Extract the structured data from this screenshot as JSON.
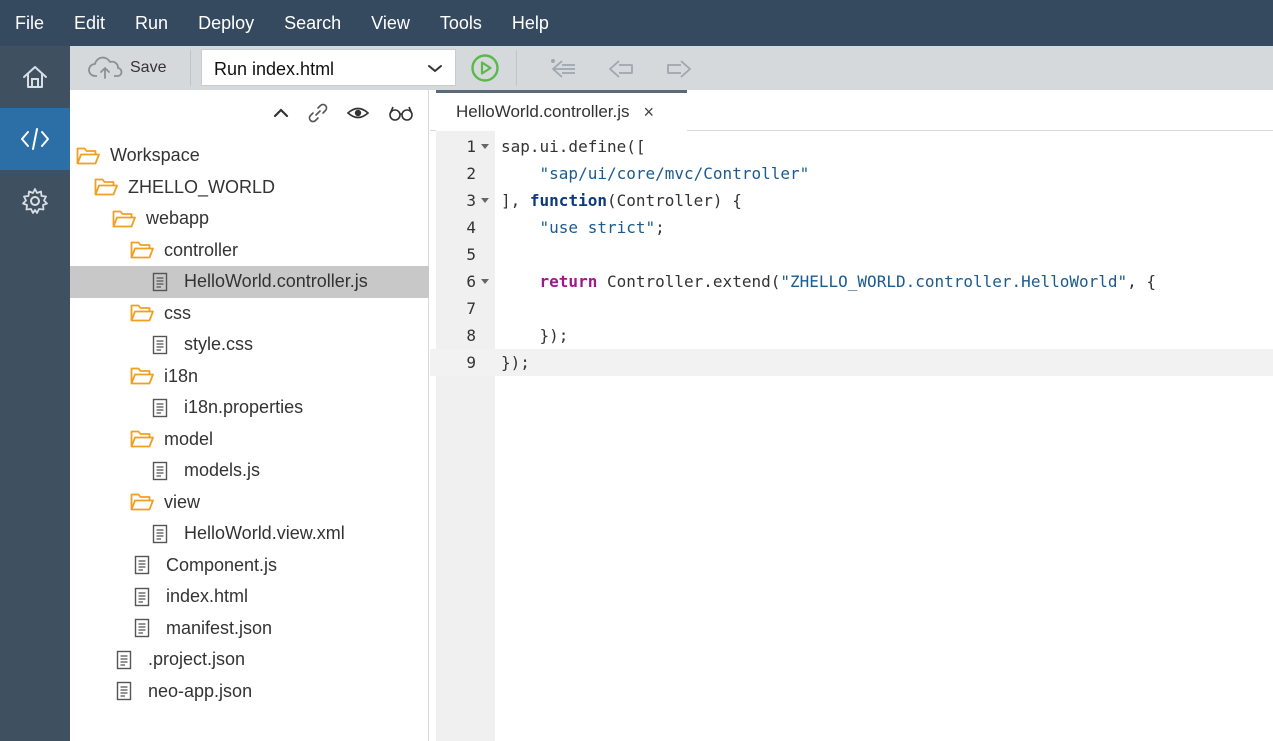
{
  "menu": [
    "File",
    "Edit",
    "Run",
    "Deploy",
    "Search",
    "View",
    "Tools",
    "Help"
  ],
  "rail": {
    "items": [
      {
        "icon": "home-icon"
      },
      {
        "icon": "code-editor-icon",
        "active": true
      },
      {
        "icon": "gear-icon"
      }
    ]
  },
  "toolbar": {
    "save_label": "Save",
    "run_config": "Run index.html",
    "icons": [
      "cloud-upload-icon",
      "chevron-down-icon",
      "run-icon",
      "previous-error-icon",
      "back-icon",
      "forward-icon"
    ]
  },
  "sidepanel": {
    "toolbar_icons": [
      "collapse-icon",
      "link-icon",
      "show-hidden-icon",
      "glasses-icon"
    ],
    "tree": [
      {
        "label": "Workspace",
        "type": "folder",
        "level": 0
      },
      {
        "label": "ZHELLO_WORLD",
        "type": "folder",
        "level": 1
      },
      {
        "label": "webapp",
        "type": "folder",
        "level": 2
      },
      {
        "label": "controller",
        "type": "folder",
        "level": 3
      },
      {
        "label": "HelloWorld.controller.js",
        "type": "file",
        "level": 4,
        "selected": true
      },
      {
        "label": "css",
        "type": "folder",
        "level": 3
      },
      {
        "label": "style.css",
        "type": "file",
        "level": 4
      },
      {
        "label": "i18n",
        "type": "folder",
        "level": 3
      },
      {
        "label": "i18n.properties",
        "type": "file",
        "level": 4
      },
      {
        "label": "model",
        "type": "folder",
        "level": 3
      },
      {
        "label": "models.js",
        "type": "file",
        "level": 4
      },
      {
        "label": "view",
        "type": "folder",
        "level": 3
      },
      {
        "label": "HelloWorld.view.xml",
        "type": "file",
        "level": 4
      },
      {
        "label": "Component.js",
        "type": "file",
        "level": 3
      },
      {
        "label": "index.html",
        "type": "file",
        "level": 3
      },
      {
        "label": "manifest.json",
        "type": "file",
        "level": 3
      },
      {
        "label": ".project.json",
        "type": "file",
        "level": 2
      },
      {
        "label": "neo-app.json",
        "type": "file",
        "level": 2
      }
    ]
  },
  "editor": {
    "tab_label": "HelloWorld.controller.js",
    "tab_close": "×",
    "lines": [
      {
        "num": "1",
        "fold": true,
        "text": "sap.ui.define(["
      },
      {
        "num": "2",
        "fold": false,
        "text": "    \"sap/ui/core/mvc/Controller\""
      },
      {
        "num": "3",
        "fold": true,
        "text": "], function(Controller) {"
      },
      {
        "num": "4",
        "fold": false,
        "text": "    \"use strict\";"
      },
      {
        "num": "5",
        "fold": false,
        "text": ""
      },
      {
        "num": "6",
        "fold": true,
        "text": "    return Controller.extend(\"ZHELLO_WORLD.controller.HelloWorld\", {"
      },
      {
        "num": "7",
        "fold": false,
        "text": ""
      },
      {
        "num": "8",
        "fold": false,
        "text": "    });"
      },
      {
        "num": "9",
        "fold": false,
        "text": "});",
        "current": true
      }
    ]
  },
  "colors": {
    "menubar": "#354a5f",
    "rail": "#3f5161",
    "rail_active": "#2c6fa6",
    "folder": "#f0a020",
    "run_green": "#5bb84a"
  }
}
